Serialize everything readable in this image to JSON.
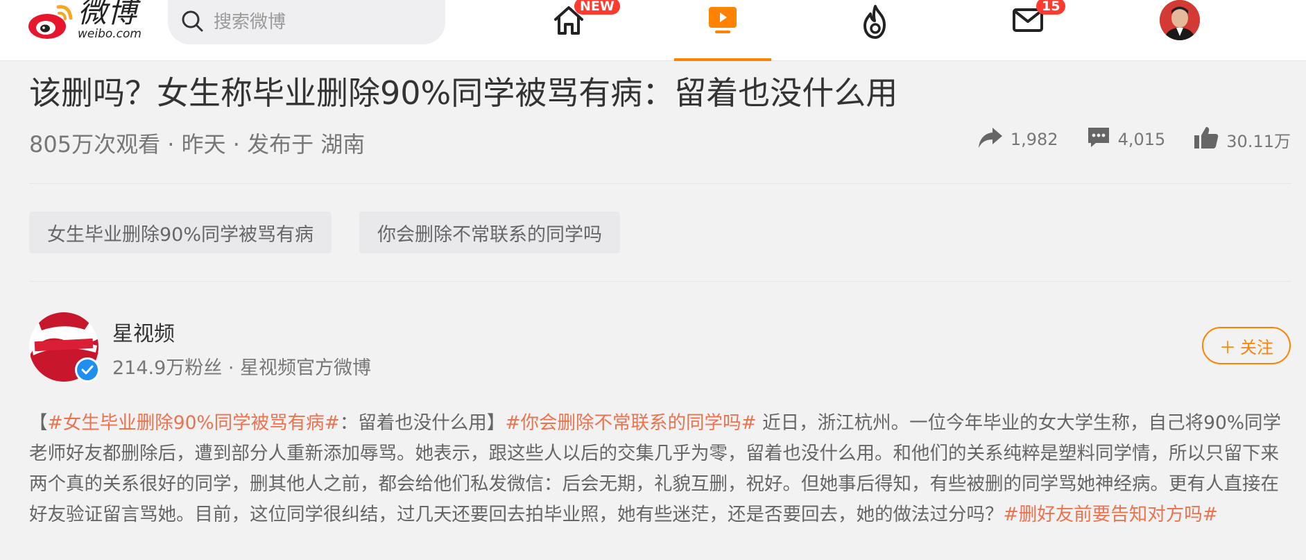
{
  "header": {
    "logo": {
      "cn": "微博",
      "en": "weibo.com"
    },
    "search": {
      "placeholder": "搜索微博"
    },
    "nav": {
      "home_badge": "NEW",
      "messages_badge": "15"
    },
    "icons": [
      "weibo-logo-icon",
      "search-icon",
      "home-icon",
      "video-icon",
      "hot-icon",
      "mail-icon"
    ]
  },
  "video": {
    "title": "该删吗？女生称毕业删除90%同学被骂有病：留着也没什么用",
    "meta": "805万次观看 · 昨天 · 发布于 湖南",
    "stats": {
      "reposts": "1,982",
      "comments": "4,015",
      "likes": "30.11万"
    },
    "tags": [
      "女生毕业删除90%同学被骂有病",
      "你会删除不常联系的同学吗"
    ]
  },
  "author": {
    "name": "星视频",
    "sub": "214.9万粉丝 · 星视频官方微博",
    "follow_label": "关注",
    "follow_plus": "＋"
  },
  "post": {
    "bracket_open": "【",
    "topic1": "#女生毕业删除90%同学被骂有病#",
    "text1": "：留着也没什么用】",
    "topic2": "#你会删除不常联系的同学吗#",
    "text2": " 近日，浙江杭州。一位今年毕业的女大学生称，自己将90%同学老师好友都删除后，遭到部分人重新添加辱骂。她表示，跟这些人以后的交集几乎为零，留着也没什么用。和他们的关系纯粹是塑料同学情，所以只留下来两个真的关系很好的同学，删其他人之前，都会给他们私发微信：后会无期，礼貌互删，祝好。但她事后得知，有些被删的同学骂她神经病。更有人直接在好友验证留言骂她。目前，这位同学很纠结，过几天还要回去拍毕业照，她有些迷茫，还是否要回去，她的做法过分吗？",
    "topic3": "#删好友前要告知对方吗#"
  },
  "colors": {
    "accent": "#ff8200",
    "topic": "#eb7350",
    "badge": "#ff3b30",
    "verified": "#1f8ef1"
  }
}
